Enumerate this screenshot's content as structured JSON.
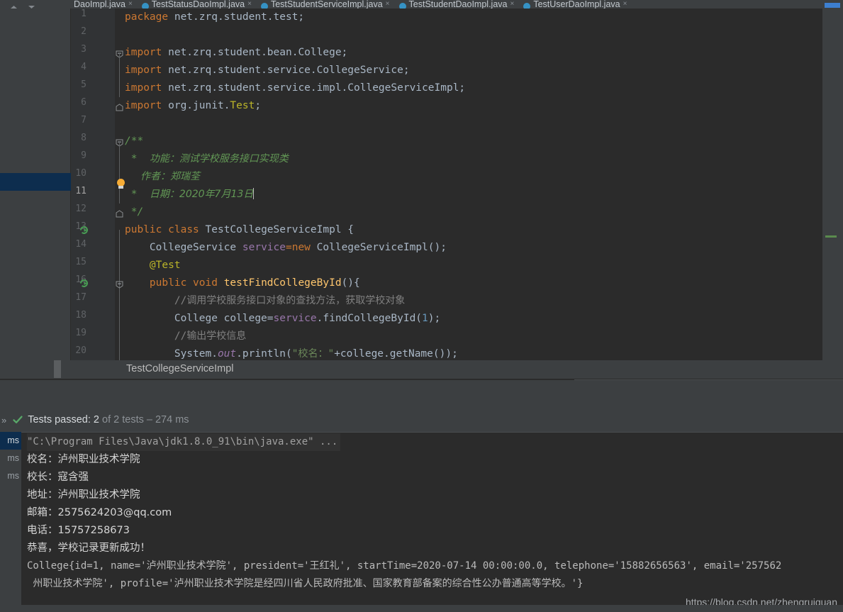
{
  "window": {
    "theme_bg": "#3c3f41",
    "editor_bg": "#2b2b2b",
    "accent_blue": "#3592c4",
    "selection_blue": "#0d2d4e"
  },
  "tabbar": {
    "tabs": [
      {
        "label": "DaoImpl.java",
        "icon": "java-class-icon",
        "active": false
      },
      {
        "label": "TestStatusDaoImpl.java",
        "icon": "java-class-icon",
        "active": false
      },
      {
        "label": "TestStudentServiceImpl.java",
        "icon": "java-class-icon",
        "active": false
      },
      {
        "label": "TestStudentDaoImpl.java",
        "icon": "java-class-icon",
        "active": false
      },
      {
        "label": "TestUserDaoImpl.java",
        "icon": "java-class-icon",
        "active": false
      }
    ],
    "close_glyph": "×"
  },
  "editor": {
    "current_line": 11,
    "lines": [
      {
        "n": 1,
        "run": false,
        "fold": "none"
      },
      {
        "n": 2,
        "run": false,
        "fold": "none"
      },
      {
        "n": 3,
        "run": false,
        "fold": "start"
      },
      {
        "n": 4,
        "run": false,
        "fold": "body"
      },
      {
        "n": 5,
        "run": false,
        "fold": "body"
      },
      {
        "n": 6,
        "run": false,
        "fold": "end"
      },
      {
        "n": 7,
        "run": false,
        "fold": "none"
      },
      {
        "n": 8,
        "run": false,
        "fold": "start"
      },
      {
        "n": 9,
        "run": false,
        "fold": "body"
      },
      {
        "n": 10,
        "run": false,
        "fold": "body"
      },
      {
        "n": 11,
        "run": false,
        "fold": "body"
      },
      {
        "n": 12,
        "run": false,
        "fold": "end"
      },
      {
        "n": 13,
        "run": true,
        "fold": "none"
      },
      {
        "n": 14,
        "run": false,
        "fold": "none"
      },
      {
        "n": 15,
        "run": false,
        "fold": "none"
      },
      {
        "n": 16,
        "run": true,
        "fold": "start"
      },
      {
        "n": 17,
        "run": false,
        "fold": "none"
      },
      {
        "n": 18,
        "run": false,
        "fold": "none"
      },
      {
        "n": 19,
        "run": false,
        "fold": "none"
      },
      {
        "n": 20,
        "run": false,
        "fold": "none"
      }
    ],
    "code": {
      "l1_package_kw": "package",
      "l1_package_name": " net.zrq.student.test;",
      "l3_import_kw": "import",
      "l3_rest": " net.zrq.student.bean.College;",
      "l4_import_kw": "import",
      "l4_rest": " net.zrq.student.service.CollegeService;",
      "l5_import_kw": "import",
      "l5_rest": " net.zrq.student.service.impl.CollegeServiceImpl;",
      "l6_import_kw": "import",
      "l6_rest": " org.junit.",
      "l6_test": "Test",
      "l6_semi": ";",
      "l8_doc_open": "/**",
      "l9_star": " *  ",
      "l9_text": "功能：测试学校服务接口实现类",
      "l10_text": "作者：郑瑞荃",
      "l11_star": " *  ",
      "l11_text": "日期：2020年7月13日",
      "l12_doc_close": " */",
      "l13_public": "public",
      "l13_class": "class",
      "l13_name": " TestCollegeServiceImpl {",
      "l14_type": "    CollegeService ",
      "l14_field": "service",
      "l14_eq": "=",
      "l14_new": "new",
      "l14_rest": " CollegeServiceImpl();",
      "l15_annotation": "    @Test",
      "l16_public": "    public",
      "l16_void": " void",
      "l16_method": " testFindCollegeById",
      "l16_rest": "(){",
      "l17_comment": "        //",
      "l17_comment_cn": "调用学校服务接口对象的查找方法，获取学校对象",
      "l18_type": "        College college=",
      "l18_field": "service",
      "l18_call": ".findCollegeById(",
      "l18_num": "1",
      "l18_end": ");",
      "l19_comment": "        //",
      "l19_comment_cn": "输出学校信息",
      "l20_sys": "        System.",
      "l20_out": "out",
      "l20_println": ".println(",
      "l20_str_open": "\"",
      "l20_str_cn": "校名：",
      "l20_str_close": "\"",
      "l20_rest": "+college.getName());"
    }
  },
  "breadcrumb": {
    "label": "TestCollegeServiceImpl"
  },
  "test_runner": {
    "expand_glyph": "»",
    "status_icon": "green-check-icon",
    "status_prefix": "Tests passed: ",
    "status_count": "2",
    "status_suffix": " of 2 tests – 274 ms",
    "tree_rows": [
      {
        "time": "ms",
        "selected": true
      },
      {
        "time": "ms",
        "selected": false
      },
      {
        "time": "ms",
        "selected": false
      }
    ],
    "console": [
      {
        "text": "\"C:\\Program Files\\Java\\jdk1.8.0_91\\bin\\java.exe\" ...",
        "type": "cmd"
      },
      {
        "text": "校名：泸州职业技术学院",
        "type": "cn"
      },
      {
        "text": "校长：寇含强",
        "type": "cn"
      },
      {
        "text": "地址：泸州职业技术学院",
        "type": "cn"
      },
      {
        "text": "邮箱：2575624203@qq.com",
        "type": "cn"
      },
      {
        "text": "电话：15757258673",
        "type": "cn"
      },
      {
        "text": "恭喜，学校记录更新成功！",
        "type": "cn"
      },
      {
        "text": "College{id=1, name='泸州职业技术学院', president='王红礼', startTime=2020-07-14 00:00:00.0, telephone='15882656563', email='257562",
        "type": "mono"
      },
      {
        "text": " 州职业技术学院', profile='泸州职业技术学院是经四川省人民政府批准、国家教育部备案的综合性公办普通高等学校。'}",
        "type": "mono"
      }
    ]
  },
  "watermark": {
    "text": "https://blog.csdn.net/zhengruiquan"
  }
}
